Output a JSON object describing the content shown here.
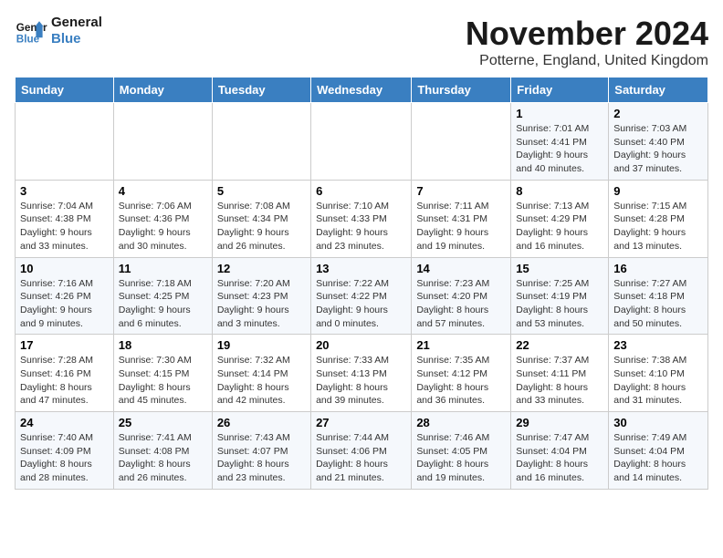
{
  "logo": {
    "line1": "General",
    "line2": "Blue"
  },
  "title": "November 2024",
  "subtitle": "Potterne, England, United Kingdom",
  "days_header": [
    "Sunday",
    "Monday",
    "Tuesday",
    "Wednesday",
    "Thursday",
    "Friday",
    "Saturday"
  ],
  "weeks": [
    [
      {
        "day": "",
        "info": ""
      },
      {
        "day": "",
        "info": ""
      },
      {
        "day": "",
        "info": ""
      },
      {
        "day": "",
        "info": ""
      },
      {
        "day": "",
        "info": ""
      },
      {
        "day": "1",
        "info": "Sunrise: 7:01 AM\nSunset: 4:41 PM\nDaylight: 9 hours\nand 40 minutes."
      },
      {
        "day": "2",
        "info": "Sunrise: 7:03 AM\nSunset: 4:40 PM\nDaylight: 9 hours\nand 37 minutes."
      }
    ],
    [
      {
        "day": "3",
        "info": "Sunrise: 7:04 AM\nSunset: 4:38 PM\nDaylight: 9 hours\nand 33 minutes."
      },
      {
        "day": "4",
        "info": "Sunrise: 7:06 AM\nSunset: 4:36 PM\nDaylight: 9 hours\nand 30 minutes."
      },
      {
        "day": "5",
        "info": "Sunrise: 7:08 AM\nSunset: 4:34 PM\nDaylight: 9 hours\nand 26 minutes."
      },
      {
        "day": "6",
        "info": "Sunrise: 7:10 AM\nSunset: 4:33 PM\nDaylight: 9 hours\nand 23 minutes."
      },
      {
        "day": "7",
        "info": "Sunrise: 7:11 AM\nSunset: 4:31 PM\nDaylight: 9 hours\nand 19 minutes."
      },
      {
        "day": "8",
        "info": "Sunrise: 7:13 AM\nSunset: 4:29 PM\nDaylight: 9 hours\nand 16 minutes."
      },
      {
        "day": "9",
        "info": "Sunrise: 7:15 AM\nSunset: 4:28 PM\nDaylight: 9 hours\nand 13 minutes."
      }
    ],
    [
      {
        "day": "10",
        "info": "Sunrise: 7:16 AM\nSunset: 4:26 PM\nDaylight: 9 hours\nand 9 minutes."
      },
      {
        "day": "11",
        "info": "Sunrise: 7:18 AM\nSunset: 4:25 PM\nDaylight: 9 hours\nand 6 minutes."
      },
      {
        "day": "12",
        "info": "Sunrise: 7:20 AM\nSunset: 4:23 PM\nDaylight: 9 hours\nand 3 minutes."
      },
      {
        "day": "13",
        "info": "Sunrise: 7:22 AM\nSunset: 4:22 PM\nDaylight: 9 hours\nand 0 minutes."
      },
      {
        "day": "14",
        "info": "Sunrise: 7:23 AM\nSunset: 4:20 PM\nDaylight: 8 hours\nand 57 minutes."
      },
      {
        "day": "15",
        "info": "Sunrise: 7:25 AM\nSunset: 4:19 PM\nDaylight: 8 hours\nand 53 minutes."
      },
      {
        "day": "16",
        "info": "Sunrise: 7:27 AM\nSunset: 4:18 PM\nDaylight: 8 hours\nand 50 minutes."
      }
    ],
    [
      {
        "day": "17",
        "info": "Sunrise: 7:28 AM\nSunset: 4:16 PM\nDaylight: 8 hours\nand 47 minutes."
      },
      {
        "day": "18",
        "info": "Sunrise: 7:30 AM\nSunset: 4:15 PM\nDaylight: 8 hours\nand 45 minutes."
      },
      {
        "day": "19",
        "info": "Sunrise: 7:32 AM\nSunset: 4:14 PM\nDaylight: 8 hours\nand 42 minutes."
      },
      {
        "day": "20",
        "info": "Sunrise: 7:33 AM\nSunset: 4:13 PM\nDaylight: 8 hours\nand 39 minutes."
      },
      {
        "day": "21",
        "info": "Sunrise: 7:35 AM\nSunset: 4:12 PM\nDaylight: 8 hours\nand 36 minutes."
      },
      {
        "day": "22",
        "info": "Sunrise: 7:37 AM\nSunset: 4:11 PM\nDaylight: 8 hours\nand 33 minutes."
      },
      {
        "day": "23",
        "info": "Sunrise: 7:38 AM\nSunset: 4:10 PM\nDaylight: 8 hours\nand 31 minutes."
      }
    ],
    [
      {
        "day": "24",
        "info": "Sunrise: 7:40 AM\nSunset: 4:09 PM\nDaylight: 8 hours\nand 28 minutes."
      },
      {
        "day": "25",
        "info": "Sunrise: 7:41 AM\nSunset: 4:08 PM\nDaylight: 8 hours\nand 26 minutes."
      },
      {
        "day": "26",
        "info": "Sunrise: 7:43 AM\nSunset: 4:07 PM\nDaylight: 8 hours\nand 23 minutes."
      },
      {
        "day": "27",
        "info": "Sunrise: 7:44 AM\nSunset: 4:06 PM\nDaylight: 8 hours\nand 21 minutes."
      },
      {
        "day": "28",
        "info": "Sunrise: 7:46 AM\nSunset: 4:05 PM\nDaylight: 8 hours\nand 19 minutes."
      },
      {
        "day": "29",
        "info": "Sunrise: 7:47 AM\nSunset: 4:04 PM\nDaylight: 8 hours\nand 16 minutes."
      },
      {
        "day": "30",
        "info": "Sunrise: 7:49 AM\nSunset: 4:04 PM\nDaylight: 8 hours\nand 14 minutes."
      }
    ]
  ]
}
